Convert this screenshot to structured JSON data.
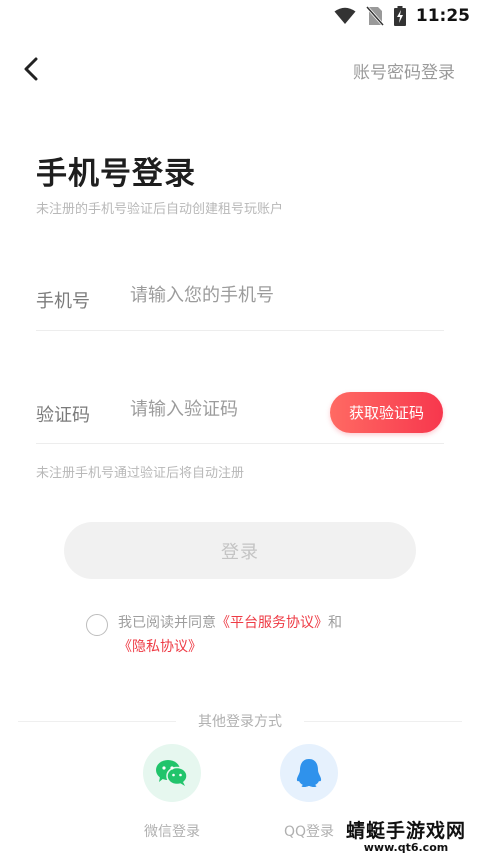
{
  "status_bar": {
    "time": "11:25",
    "icons": [
      "wifi-icon",
      "no-sim-icon",
      "battery-charging-icon"
    ]
  },
  "header": {
    "back_icon": "chevron-left-icon",
    "account_login_label": "账号密码登录"
  },
  "title": "手机号登录",
  "subtitle": "未注册的手机号验证后自动创建租号玩账户",
  "phone_field": {
    "label": "手机号",
    "placeholder": "请输入您的手机号",
    "value": ""
  },
  "code_field": {
    "label": "验证码",
    "placeholder": "请输入验证码",
    "value": ""
  },
  "get_code_label": "获取验证码",
  "hint": "未注册手机号通过验证后将自动注册",
  "login_label": "登录",
  "agreement": {
    "prefix": "我已阅读并同意",
    "platform_link": "《平台服务协议》",
    "and": "和",
    "privacy_link": "《隐私协议》",
    "checked": false
  },
  "other_login": {
    "title": "其他登录方式",
    "wechat_label": "微信登录",
    "qq_label": "QQ登录"
  },
  "watermark": {
    "main": "蜻蜓手游戏网",
    "sub": "www.qt6.com"
  },
  "colors": {
    "accent": "#f7374d",
    "link": "#ee3b45",
    "wechat": "#21c46b",
    "qq": "#2f92ec"
  }
}
